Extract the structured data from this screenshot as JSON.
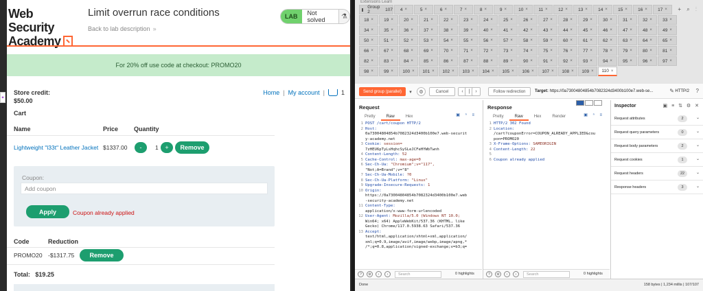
{
  "lab": {
    "logo_line1": "Web Security",
    "logo_line2": "Academy",
    "title": "Limit overrun race conditions",
    "back_link": "Back to lab description",
    "back_chevron": "»",
    "lab_tag": "LAB",
    "status": "Not solved",
    "flask_icon": "flask-icon",
    "banner": "For 20% off use code at checkout: PROMO20",
    "nav_home": "Home",
    "nav_sep": "|",
    "nav_account": "My account",
    "cart_count": "1",
    "store_credit_label": "Store credit:",
    "store_credit_value": "$50.00",
    "cart_heading": "Cart",
    "col_name": "Name",
    "col_price": "Price",
    "col_quantity": "Quantity",
    "item_name": "Lightweight \"l33t\" Leather Jacket",
    "item_price": "$1337.00",
    "qty_minus": "-",
    "qty_value": "1",
    "qty_plus": "+",
    "remove_label": "Remove",
    "coupon_label": "Coupon:",
    "coupon_placeholder": "Add coupon",
    "apply_label": "Apply",
    "coupon_error": "Coupon already applied",
    "col_code": "Code",
    "col_reduction": "Reduction",
    "code_value": "PROMO20",
    "reduction_value": "-$1317.75",
    "total_label": "Total:",
    "total_value": "$19.25",
    "colors": {
      "accent": "#ff6633",
      "green": "#1d9e6f",
      "link": "#0071bc",
      "error": "#cc1111"
    }
  },
  "burp": {
    "top_strip": "Extensions    Learn",
    "group_label": "Group 2",
    "group_count": "107",
    "tabs": [
      "4",
      "5",
      "6",
      "7",
      "8",
      "9",
      "10",
      "11",
      "12",
      "13",
      "14",
      "15",
      "16",
      "17",
      "18",
      "19",
      "20",
      "21",
      "22",
      "23",
      "24",
      "25",
      "26",
      "27",
      "28",
      "29",
      "30",
      "31",
      "32",
      "33",
      "34",
      "35",
      "36",
      "37",
      "38",
      "39",
      "40",
      "41",
      "42",
      "43",
      "44",
      "45",
      "46",
      "47",
      "48",
      "49",
      "50",
      "51",
      "52",
      "53",
      "54",
      "55",
      "56",
      "57",
      "58",
      "59",
      "60",
      "61",
      "62",
      "63",
      "64",
      "65",
      "66",
      "67",
      "68",
      "69",
      "70",
      "71",
      "72",
      "73",
      "74",
      "75",
      "76",
      "77",
      "78",
      "79",
      "80",
      "81",
      "82",
      "83",
      "84",
      "85",
      "86",
      "87",
      "88",
      "89",
      "90",
      "91",
      "92",
      "93",
      "94",
      "95",
      "96",
      "97",
      "98",
      "99",
      "100",
      "101",
      "102",
      "103",
      "104",
      "105",
      "106",
      "107",
      "108",
      "109",
      "110"
    ],
    "tab_close": "×",
    "tab_controls": "+ ⌕ ⋮",
    "send_label": "Send group (parallel)",
    "cancel_label": "Cancel",
    "follow_label": "Follow redirection",
    "target_label": "Target:",
    "target_url": "https://0a73004804854b7082324d3400b100e7.web-se...",
    "http_version": "HTTP/2",
    "request_heading": "Request",
    "response_heading": "Response",
    "req_tabs": [
      "Pretty",
      "Raw",
      "Hex"
    ],
    "resp_tabs": [
      "Pretty",
      "Raw",
      "Hex",
      "Render"
    ],
    "request_lines": [
      {
        "n": "1",
        "k": "POST /cart/coupon HTTP/2",
        "v": "",
        "w": []
      },
      {
        "n": "2",
        "k": "Host:",
        "v": "",
        "w": [
          "0a73004804854b7082324d3400b100e7.web-securit",
          "y-academy.net"
        ]
      },
      {
        "n": "3",
        "k": "Cookie:",
        "v": "session=",
        "w": [
          "7zHEU6pTyLsHqhcSySLeJCFeHYWbTwnh"
        ]
      },
      {
        "n": "4",
        "k": "Content-Length:",
        "v": "52",
        "w": []
      },
      {
        "n": "5",
        "k": "Cache-Control:",
        "v": "max-age=0",
        "w": []
      },
      {
        "n": "6",
        "k": "Sec-Ch-Ua:",
        "v": "\"Chromium\";v=\"117\",",
        "w": [
          "\"Not;A=Brand\";v=\"8\""
        ]
      },
      {
        "n": "7",
        "k": "Sec-Ch-Ua-Mobile:",
        "v": "?0",
        "w": []
      },
      {
        "n": "8",
        "k": "Sec-Ch-Ua-Platform:",
        "v": "\"Linux\"",
        "w": []
      },
      {
        "n": "9",
        "k": "Upgrade-Insecure-Requests:",
        "v": "1",
        "w": []
      },
      {
        "n": "10",
        "k": "Origin:",
        "v": "",
        "w": [
          "https://0a73004804854b7082324d3400b100e7.web",
          "-security-academy.net"
        ]
      },
      {
        "n": "11",
        "k": "Content-Type:",
        "v": "",
        "w": [
          "application/x-www-form-urlencoded"
        ]
      },
      {
        "n": "12",
        "k": "User-Agent:",
        "v": "Mozilla/5.0 (Windows NT 10.0;",
        "w": [
          "Win64; x64) AppleWebKit/537.36 (KHTML, like",
          "Gecko) Chrome/117.0.5938.63 Safari/537.36"
        ]
      },
      {
        "n": "13",
        "k": "Accept:",
        "v": "",
        "w": [
          "text/html,application/xhtml+xml,application/",
          "xml;q=0.9,image/avif,image/webp,image/apng,*",
          "/*;q=0.8,application/signed-exchange;v=b3;q="
        ]
      }
    ],
    "response_lines": [
      {
        "n": "1",
        "k": "HTTP/2 302 Found",
        "v": "",
        "w": []
      },
      {
        "n": "2",
        "k": "Location:",
        "v": "",
        "w": [
          "/cart?couponError=COUPON_ALREADY_APPLIED&cou",
          "pon=PROMO20"
        ]
      },
      {
        "n": "3",
        "k": "X-Frame-Options:",
        "v": "SAMEORIGIN",
        "w": []
      },
      {
        "n": "4",
        "k": "Content-Length:",
        "v": "22",
        "w": []
      },
      {
        "n": "5",
        "k": "",
        "v": "",
        "w": []
      },
      {
        "n": "6",
        "k": "Coupon already applied",
        "v": "",
        "w": []
      }
    ],
    "search_placeholder": "Search",
    "highlights": "0 highlights",
    "inspector_heading": "Inspector",
    "inspector_rows": [
      {
        "label": "Request attributes",
        "count": "2"
      },
      {
        "label": "Request query parameters",
        "count": "0"
      },
      {
        "label": "Request body parameters",
        "count": "2"
      },
      {
        "label": "Request cookies",
        "count": "1"
      },
      {
        "label": "Request headers",
        "count": "22"
      },
      {
        "label": "Response headers",
        "count": "3"
      }
    ],
    "status_done": "Done",
    "status_stats": "158 bytes | 1,234 millis | 107/107"
  }
}
